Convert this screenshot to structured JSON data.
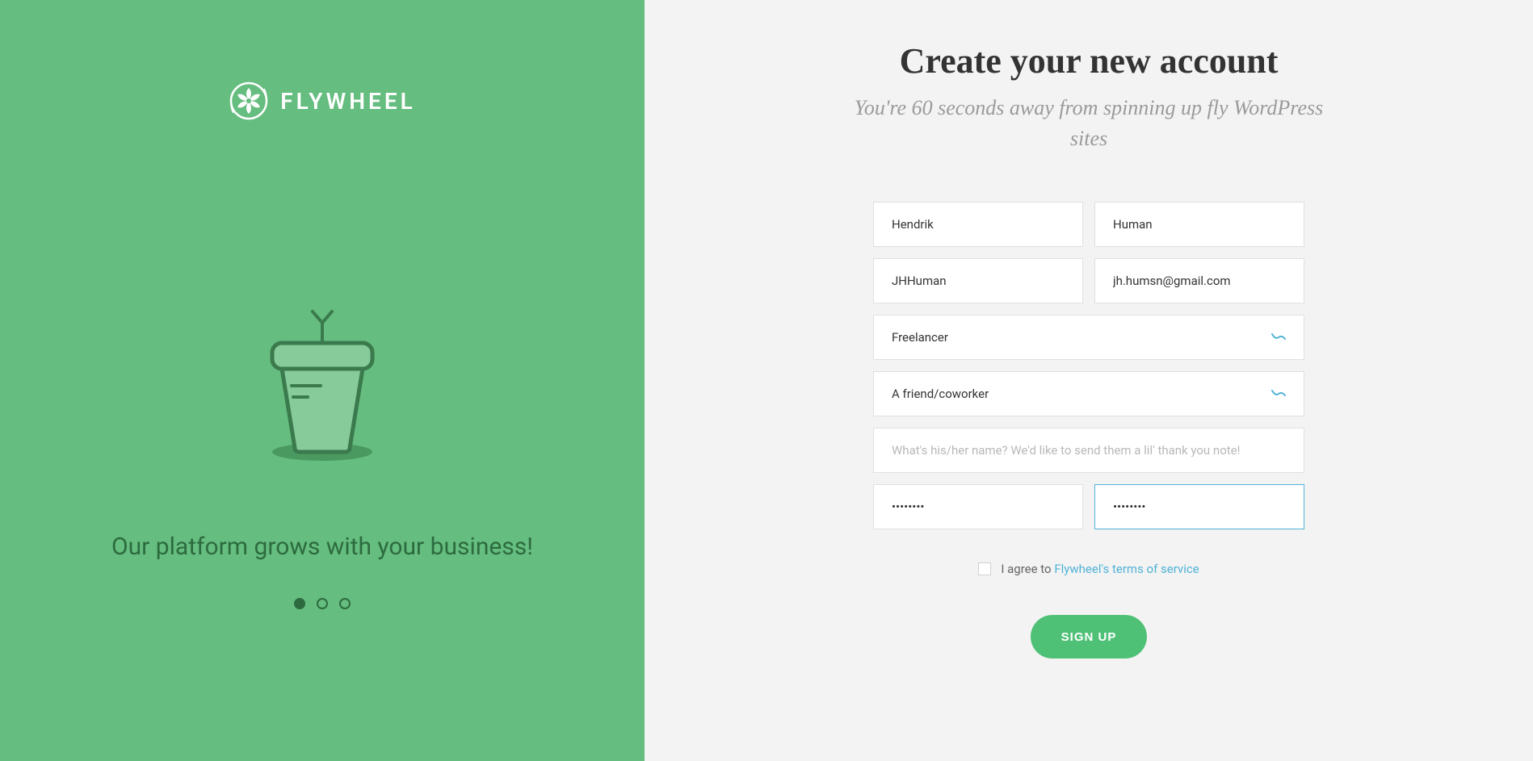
{
  "left": {
    "brand": "FLYWHEEL",
    "tagline": "Our platform grows with your business!",
    "active_dot_index": 0,
    "dot_count": 3
  },
  "form": {
    "heading": "Create your new account",
    "subheading": "You're 60 seconds away from spinning up fly WordPress sites",
    "first_name": "Hendrik",
    "last_name": "Human",
    "username": "JHHuman",
    "email": "jh.humsn@gmail.com",
    "role": "Freelancer",
    "referral_source": "A friend/coworker",
    "referral_name_placeholder": "What's his/her name? We'd like to send them a lil' thank you note!",
    "referral_name": "",
    "password": "••••••••",
    "password_confirm": "••••••••",
    "agree_text": "I agree to ",
    "tos_link_text": "Flywheel's terms of service",
    "agree_checked": false,
    "signup_label": "SIGN UP"
  }
}
